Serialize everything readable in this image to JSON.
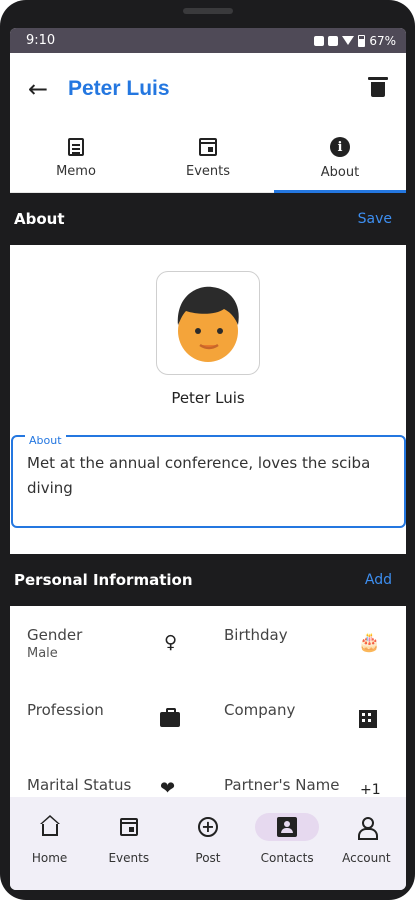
{
  "status_bar": {
    "time": "9:10",
    "battery": "67%"
  },
  "header": {
    "title": "Peter Luis",
    "back_icon": "arrow-left-icon",
    "delete_icon": "trash-icon"
  },
  "tabs": [
    {
      "label": "Memo",
      "icon": "memo-icon",
      "selected": false
    },
    {
      "label": "Events",
      "icon": "calendar-icon",
      "selected": false
    },
    {
      "label": "About",
      "icon": "info-icon",
      "selected": true
    }
  ],
  "about_section": {
    "title": "About",
    "save_label": "Save",
    "name": "Peter Luis",
    "field_label": "About",
    "field_value": "Met at the annual conference, loves the sciba diving"
  },
  "personal_info": {
    "title": "Personal Information",
    "add_label": "Add",
    "fields": [
      {
        "label": "Gender",
        "value": "Male",
        "icon": "female-symbol-icon"
      },
      {
        "label": "Birthday",
        "value": "",
        "icon": "cake-icon"
      },
      {
        "label": "Profession",
        "value": "",
        "icon": "briefcase-icon"
      },
      {
        "label": "Company",
        "value": "",
        "icon": "building-icon"
      },
      {
        "label": "Marital Status",
        "value": "",
        "icon": "heart-icon"
      },
      {
        "label": "Partner's Name",
        "value": "",
        "icon": "plus-one-icon"
      }
    ],
    "plus_one": "+1"
  },
  "bottom_nav": [
    {
      "label": "Home",
      "icon": "home-icon",
      "active": false
    },
    {
      "label": "Events",
      "icon": "calendar-icon",
      "active": false
    },
    {
      "label": "Post",
      "icon": "add-circle-icon",
      "active": false
    },
    {
      "label": "Contacts",
      "icon": "contacts-icon",
      "active": true
    },
    {
      "label": "Account",
      "icon": "account-icon",
      "active": false
    }
  ],
  "colors": {
    "accent": "#2477e0",
    "section_bg": "#1c1c1e",
    "nav_bg": "#f1eff7",
    "active_pill": "#e6d9ef"
  }
}
